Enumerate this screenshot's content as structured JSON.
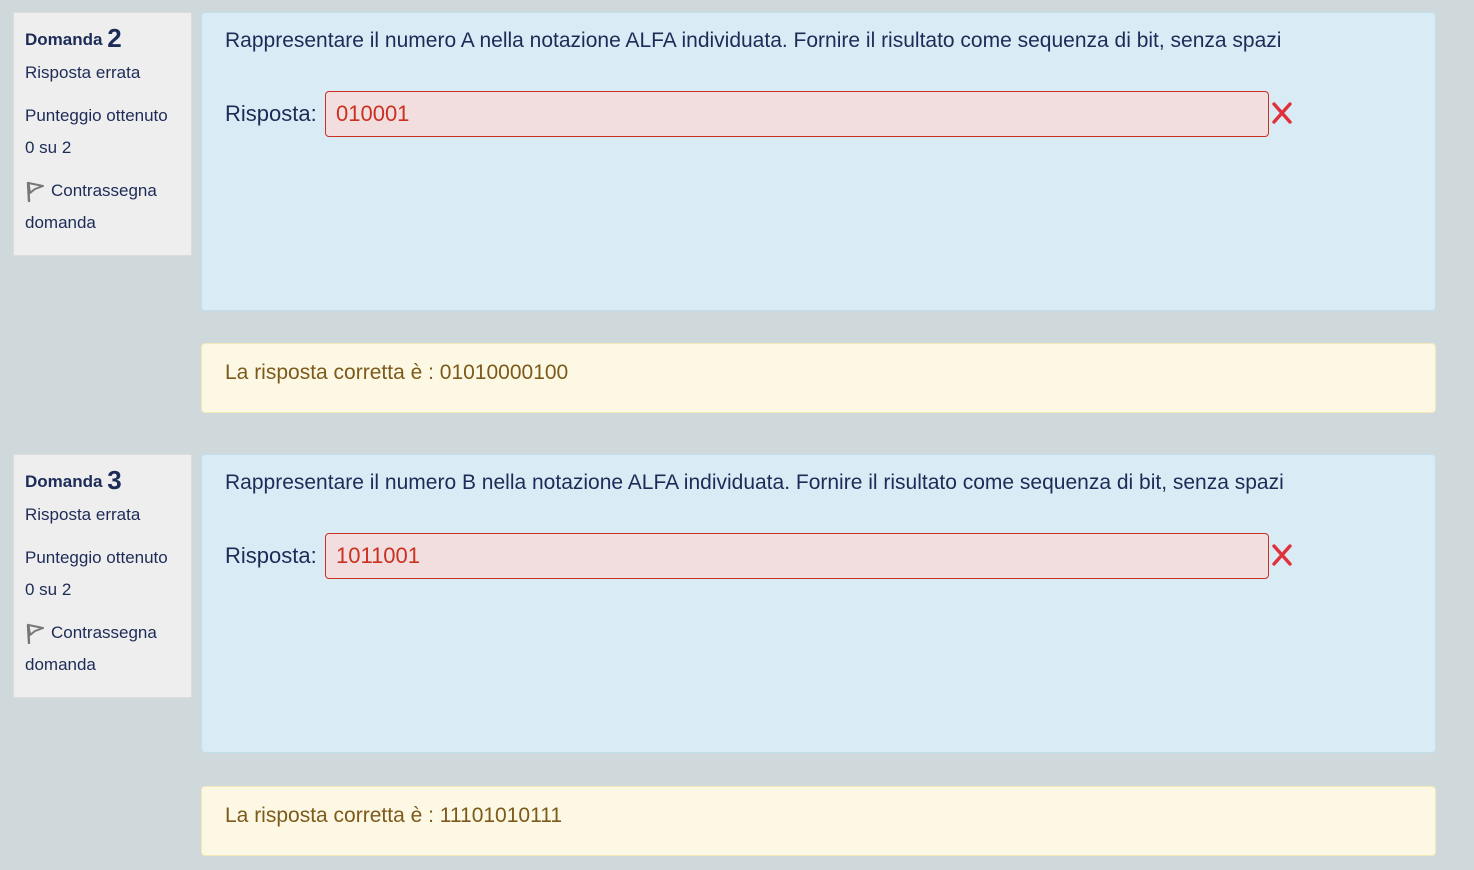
{
  "questions": [
    {
      "label": "Domanda",
      "number": "2",
      "state": "Risposta errata",
      "grade_label": "Punteggio ottenuto",
      "grade_value": "0 su 2",
      "flag_label": "Contrassegna",
      "flag_label_2": "domanda",
      "text": "Rappresentare il numero A nella notazione ALFA individuata. Fornire il risultato come sequenza di bit, senza spazi",
      "answer_label": "Risposta:",
      "answer_value": "010001",
      "right_answer": "La risposta corretta è : 01010000100"
    },
    {
      "label": "Domanda",
      "number": "3",
      "state": "Risposta errata",
      "grade_label": "Punteggio ottenuto",
      "grade_value": "0 su 2",
      "flag_label": "Contrassegna",
      "flag_label_2": "domanda",
      "text": "Rappresentare il numero B nella notazione ALFA individuata. Fornire il risultato come sequenza di bit, senza spazi",
      "answer_label": "Risposta:",
      "answer_value": "1011001",
      "right_answer": "La risposta corretta è : 11101010111"
    }
  ],
  "icons": {
    "flag": "flag-icon",
    "incorrect": "incorrect-cross-icon"
  },
  "colors": {
    "page_background": "#cfd8da",
    "question_background": "#d9ebf5",
    "feedback_background": "#fcf8e3",
    "incorrect_red": "#ca3120",
    "feedback_text": "#7d5a1b"
  }
}
